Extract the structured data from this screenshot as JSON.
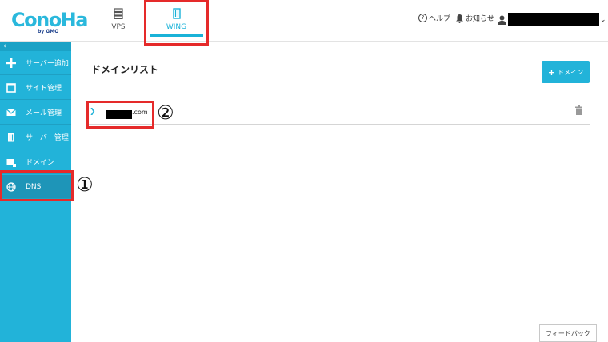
{
  "logo": {
    "text": "ConoHa",
    "sub": "by GMO"
  },
  "header": {
    "tabs": [
      {
        "label": "VPS",
        "icon": "server-icon"
      },
      {
        "label": "WING",
        "icon": "wing-server-icon",
        "active": true
      }
    ],
    "help_label": "ヘルプ",
    "notice_label": "お知らせ",
    "user_name": "████████"
  },
  "sidebar": {
    "collapse_label": "‹",
    "items": [
      {
        "label": "サーバー追加",
        "icon": "plus-icon"
      },
      {
        "label": "サイト管理",
        "icon": "site-icon"
      },
      {
        "label": "メール管理",
        "icon": "mail-icon"
      },
      {
        "label": "サーバー管理",
        "icon": "server-manage-icon"
      },
      {
        "label": "ドメイン",
        "icon": "domain-icon"
      },
      {
        "label": "DNS",
        "icon": "globe-icon",
        "active": true
      }
    ]
  },
  "annotations": {
    "mark1": "①",
    "mark2": "②"
  },
  "main": {
    "title": "ドメインリスト",
    "add_button_label": "ドメイン",
    "domains": [
      {
        "suffix": ".com"
      }
    ]
  },
  "feedback_label": "フィードバック",
  "colors": {
    "accent": "#22b3d9",
    "highlight": "#e52a2a"
  }
}
